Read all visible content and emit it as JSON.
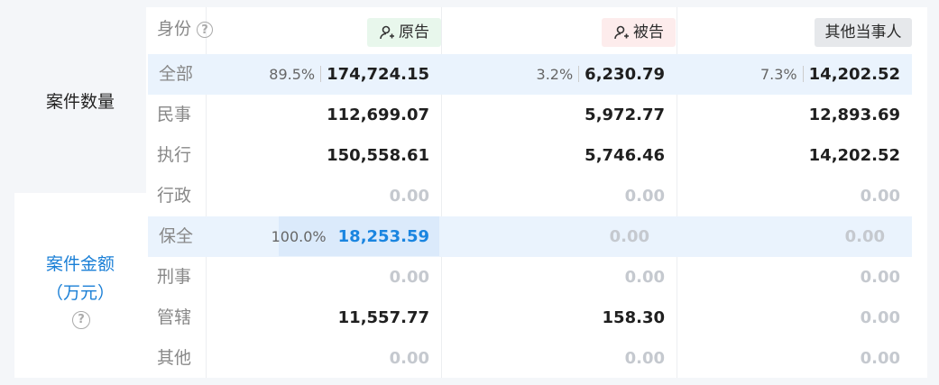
{
  "left": {
    "top_label": "案件数量",
    "bottom_label_1": "案件金额",
    "bottom_label_2": "（万元）",
    "help_icon": "question-circle-icon"
  },
  "header": {
    "identity": "身份",
    "help_icon": "question-circle-icon",
    "plaintiff": "原告",
    "defendant": "被告",
    "other": "其他当事人"
  },
  "rows": [
    {
      "label": "全部",
      "p_pct": "89.5%",
      "p": "174,724.15",
      "d_pct": "3.2%",
      "d": "6,230.79",
      "o_pct": "7.3%",
      "o": "14,202.52"
    },
    {
      "label": "民事",
      "p": "112,699.07",
      "d": "5,972.77",
      "o": "12,893.69"
    },
    {
      "label": "执行",
      "p": "150,558.61",
      "d": "5,746.46",
      "o": "14,202.52"
    },
    {
      "label": "行政",
      "p": "0.00",
      "d": "0.00",
      "o": "0.00"
    },
    {
      "label": "保全",
      "p_pct": "100.0%",
      "p": "18,253.59",
      "d": "0.00",
      "o": "0.00"
    },
    {
      "label": "刑事",
      "p": "0.00",
      "d": "0.00",
      "o": "0.00"
    },
    {
      "label": "管辖",
      "p": "11,557.77",
      "d": "158.30",
      "o": "0.00"
    },
    {
      "label": "其他",
      "p": "0.00",
      "d": "0.00",
      "o": "0.00"
    }
  ],
  "colors": {
    "plaintiff_badge_bg": "#e8f7ec",
    "defendant_badge_bg": "#fdecec",
    "other_badge_bg": "#e6e8eb",
    "accent": "#1a85e0"
  }
}
